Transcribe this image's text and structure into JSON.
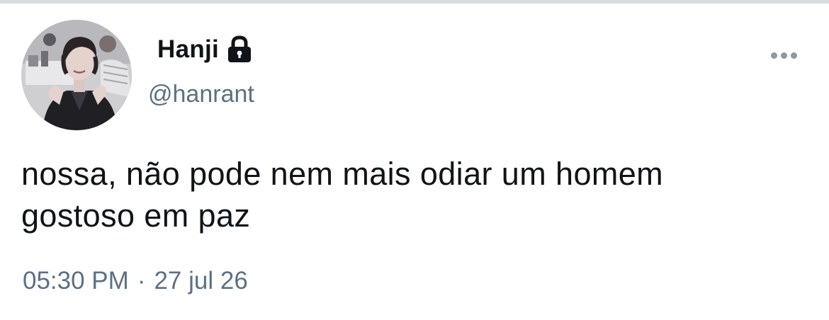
{
  "tweet": {
    "author": {
      "display_name": "Hanji",
      "handle": "@hanrant",
      "protected_icon": "lock-icon",
      "avatar": "avatar-photo"
    },
    "more_icon": "more-horizontal-icon",
    "text": "nossa, não pode nem mais odiar um homem\ngostoso em paz",
    "time": "05:30 PM",
    "separator": "·",
    "date": "27 jul 26"
  },
  "colors": {
    "primary_text": "#0f1419",
    "secondary_text": "#5b7083",
    "icon_gray": "#8b98a5",
    "divider": "#d8dce0",
    "background": "#ffffff"
  }
}
